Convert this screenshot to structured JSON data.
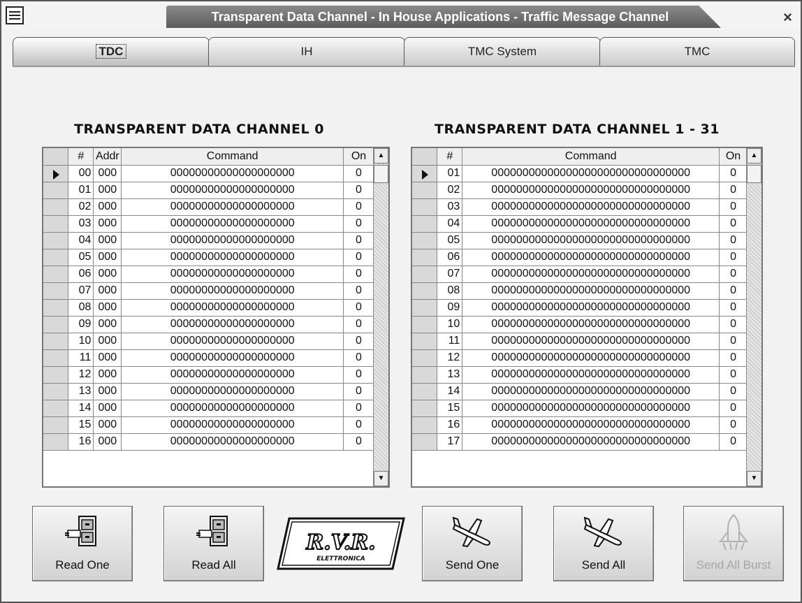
{
  "window": {
    "title": "Transparent Data Channel - In House Applications - Traffic Message Channel",
    "close_glyph": "×"
  },
  "tabs": [
    {
      "label": "TDC",
      "active": true
    },
    {
      "label": "IH",
      "active": false
    },
    {
      "label": "TMC System",
      "active": false
    },
    {
      "label": "TMC",
      "active": false
    }
  ],
  "tdc0": {
    "title": "TRANSPARENT DATA CHANNEL 0",
    "headers": {
      "num": "#",
      "addr": "Addr",
      "command": "Command",
      "on": "On"
    },
    "rows": [
      {
        "num": "00",
        "addr": "000",
        "command": "00000000000000000000",
        "on": "0"
      },
      {
        "num": "01",
        "addr": "000",
        "command": "00000000000000000000",
        "on": "0"
      },
      {
        "num": "02",
        "addr": "000",
        "command": "00000000000000000000",
        "on": "0"
      },
      {
        "num": "03",
        "addr": "000",
        "command": "00000000000000000000",
        "on": "0"
      },
      {
        "num": "04",
        "addr": "000",
        "command": "00000000000000000000",
        "on": "0"
      },
      {
        "num": "05",
        "addr": "000",
        "command": "00000000000000000000",
        "on": "0"
      },
      {
        "num": "06",
        "addr": "000",
        "command": "00000000000000000000",
        "on": "0"
      },
      {
        "num": "07",
        "addr": "000",
        "command": "00000000000000000000",
        "on": "0"
      },
      {
        "num": "08",
        "addr": "000",
        "command": "00000000000000000000",
        "on": "0"
      },
      {
        "num": "09",
        "addr": "000",
        "command": "00000000000000000000",
        "on": "0"
      },
      {
        "num": "10",
        "addr": "000",
        "command": "00000000000000000000",
        "on": "0"
      },
      {
        "num": "11",
        "addr": "000",
        "command": "00000000000000000000",
        "on": "0"
      },
      {
        "num": "12",
        "addr": "000",
        "command": "00000000000000000000",
        "on": "0"
      },
      {
        "num": "13",
        "addr": "000",
        "command": "00000000000000000000",
        "on": "0"
      },
      {
        "num": "14",
        "addr": "000",
        "command": "00000000000000000000",
        "on": "0"
      },
      {
        "num": "15",
        "addr": "000",
        "command": "00000000000000000000",
        "on": "0"
      },
      {
        "num": "16",
        "addr": "000",
        "command": "00000000000000000000",
        "on": "0"
      }
    ]
  },
  "tdc1": {
    "title": "TRANSPARENT DATA CHANNEL 1 - 31",
    "headers": {
      "num": "#",
      "command": "Command",
      "on": "On"
    },
    "rows": [
      {
        "num": "01",
        "command": "00000000000000000000000000000000",
        "on": "0"
      },
      {
        "num": "02",
        "command": "00000000000000000000000000000000",
        "on": "0"
      },
      {
        "num": "03",
        "command": "00000000000000000000000000000000",
        "on": "0"
      },
      {
        "num": "04",
        "command": "00000000000000000000000000000000",
        "on": "0"
      },
      {
        "num": "05",
        "command": "00000000000000000000000000000000",
        "on": "0"
      },
      {
        "num": "06",
        "command": "00000000000000000000000000000000",
        "on": "0"
      },
      {
        "num": "07",
        "command": "00000000000000000000000000000000",
        "on": "0"
      },
      {
        "num": "08",
        "command": "00000000000000000000000000000000",
        "on": "0"
      },
      {
        "num": "09",
        "command": "00000000000000000000000000000000",
        "on": "0"
      },
      {
        "num": "10",
        "command": "00000000000000000000000000000000",
        "on": "0"
      },
      {
        "num": "11",
        "command": "00000000000000000000000000000000",
        "on": "0"
      },
      {
        "num": "12",
        "command": "00000000000000000000000000000000",
        "on": "0"
      },
      {
        "num": "13",
        "command": "00000000000000000000000000000000",
        "on": "0"
      },
      {
        "num": "14",
        "command": "00000000000000000000000000000000",
        "on": "0"
      },
      {
        "num": "15",
        "command": "00000000000000000000000000000000",
        "on": "0"
      },
      {
        "num": "16",
        "command": "00000000000000000000000000000000",
        "on": "0"
      },
      {
        "num": "17",
        "command": "00000000000000000000000000000000",
        "on": "0"
      }
    ]
  },
  "buttons": {
    "read_one": "Read One",
    "read_all": "Read All",
    "send_one": "Send One",
    "send_all": "Send All",
    "send_all_burst": "Send All Burst"
  },
  "logo": {
    "letters": "R.V.R.",
    "subtitle": "ELETTRONICA"
  },
  "icons": {
    "read": "file-cabinet-icon",
    "send": "airplane-icon",
    "burst": "space-shuttle-icon",
    "pointer": "row-pointer-icon"
  }
}
